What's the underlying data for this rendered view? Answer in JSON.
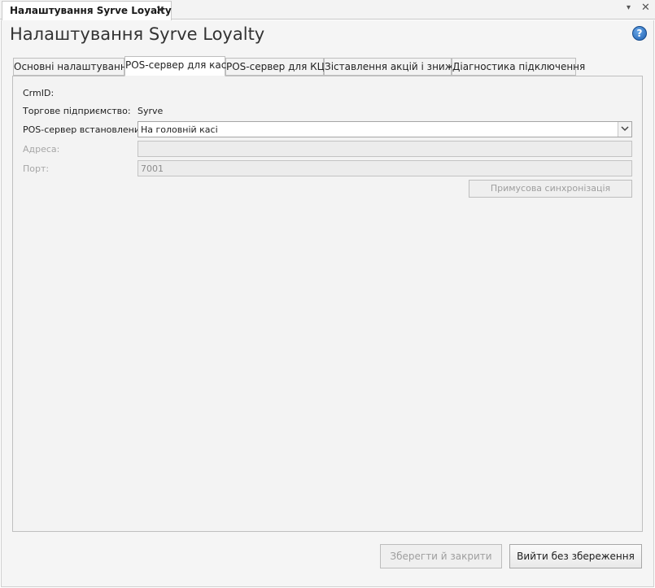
{
  "document_tab": {
    "title": "Налаштування Syrve Loyalty",
    "close_glyph": "✕"
  },
  "tabstrip_controls": {
    "dropdown_glyph": "▾",
    "close_glyph": "✕"
  },
  "page_title": "Налаштування Syrve Loyalty",
  "help_glyph": "?",
  "tabs": [
    {
      "label": "Основні налаштування",
      "active": false
    },
    {
      "label": "POS-сервер для кас",
      "active": true
    },
    {
      "label": "POS-сервер для КЦ",
      "active": false
    },
    {
      "label": "Зіставлення акцій і знижок",
      "active": false
    },
    {
      "label": "Діагностика підключення",
      "active": false
    }
  ],
  "form": {
    "crmid_label": "CrmID:",
    "crmid_value": "",
    "enterprise_label": "Торгове підприємство:",
    "enterprise_value": "Syrve",
    "pos_server_label": "POS-сервер встановлений:",
    "pos_server_value": "На головній касі",
    "address_label": "Адреса:",
    "address_value": "",
    "port_label": "Порт:",
    "port_value": "7001",
    "sync_button": "Примусова синхронізація"
  },
  "footer": {
    "save_close": "Зберегти й закрити",
    "exit_no_save": "Вийти без збереження"
  }
}
